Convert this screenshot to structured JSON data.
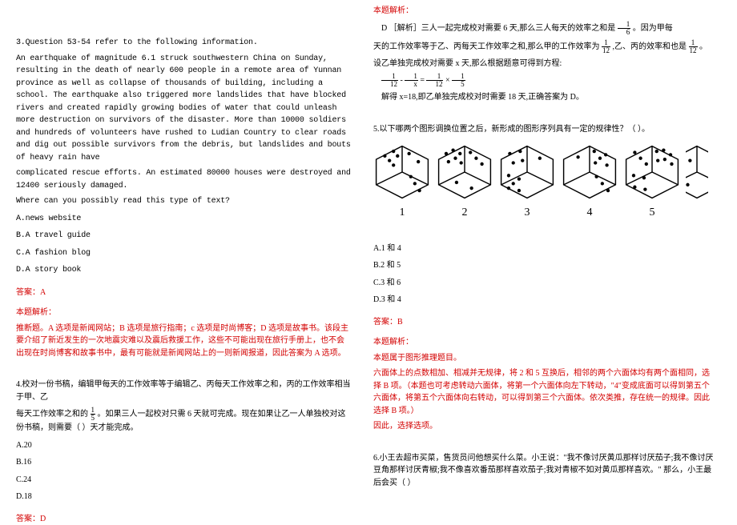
{
  "left": {
    "q3": {
      "lead": "3.Question 53-54 refer to the following information.",
      "passage": "An earthquake of magnitude 6.1 struck southwestern China on Sunday, resulting in the death of nearly 600 people in a remote area of Yunnan province as well as collapse of thousands of building, including a school. The earthquake also triggered more landslides that have blocked rivers and created rapidly growing bodies of water that could unleash more destruction on survivors of the disaster. More than 10000 soldiers and hundreds of volunteers have rushed to Ludian Country to clear roads and dig out possible survivors from the debris, but landslides and bouts of heavy rain have",
      "passage2": "complicated rescue efforts. An estimated 80000 houses were destroyed and 12400 seriously damaged.",
      "question": "Where can you possibly read this type of text?",
      "optA": "A.news website",
      "optB": "B.A travel guide",
      "optC": "C.A fashion blog",
      "optD": "D.A story book",
      "ansLabel": "答案：A",
      "explLabel": "本题解析：",
      "expl": "推断题。A 选项是新闻网站；B 选项是旅行指南；c 选项是时尚博客；D 选项是故事书。该段主要介绍了新近发生的一次地震灾难以及震后救援工作，这些不可能出现在旅行手册上，也不会出现在时尚博客和故事书中，最有可能就是新闻网站上的一则新闻报道，因此答案为 A 选项。"
    },
    "q4": {
      "stem1": "4.校对一份书稿，编辑甲每天的工作效率等于编辑乙、丙每天工作效率之和，丙的工作效率相当于甲、乙",
      "stem2a": "每天工作效率之和的",
      "stem2b": "。如果三人一起校对只需 6 天就可完成。现在如果让乙一人单独校对这份书稿，则需要（ ）天才能完成。",
      "fracN": "1",
      "fracD": "5",
      "optA": "A.20",
      "optB": "B.16",
      "optC": "C.24",
      "optD": "D.18",
      "ansLabel": "答案：D"
    }
  },
  "right": {
    "q4expl": {
      "label": "本题解析：",
      "line1a": "D ［解析］三人一起完成校对需要 6 天,那么三人每天的效率之和是",
      "line1b": "。因为甲每",
      "line2a": "天的工作效率等于乙、丙每天工作效率之和,那么甲的工作效率为",
      "line2b": ",乙、丙的效率和也是",
      "line2c": "。",
      "line3": "设乙单独完成校对需要 x 天,那么根据题意可得到方程:",
      "eq_a": " - ",
      "eq_b": " = ",
      "eq_c": "× ",
      "line4": "解得 x=18,即乙单独完成校对时需要 18 天,正确答案为 D。",
      "f6n": "1",
      "f6d": "6",
      "f12n": "1",
      "f12d": "12",
      "fxn": "1",
      "fxd": "x",
      "f5n": "1",
      "f5d": "5"
    },
    "q5": {
      "stem": "5.以下哪两个图形调换位置之后，新形成的图形序列具有一定的规律性？（ ）。",
      "nums": [
        "1",
        "2",
        "3",
        "4",
        "5"
      ],
      "optA": "A.1 和 4",
      "optB": "B.2 和 5",
      "optC": "C.3 和 6",
      "optD": "D.3 和 4",
      "ansLabel": "答案：B",
      "explLabel": "本题解析：",
      "expl1": "本题属于图形推理题目。",
      "expl2": "六面体上的点数相加、相减并无规律，将 2 和 5 互换后，相邻的两个六面体均有两个面相同，选择 B 项。（本题也可考虑转动六面体，将第一个六面体向左下转动，\"4\"变成底面可以得到第五个六面体，将第五个六面体向右转动，可以得到第三个六面体。依次类推，存在统一的规律。因此选择 B 项。）",
      "expl3": "因此，选择选项。"
    },
    "q6": {
      "stem": "6.小王去超市买菜，售货员问他想买什么菜。小王说：\"我不像讨厌黄瓜那样讨厌茄子;我不像讨厌豆角那样讨厌青椒;我不像喜欢番茄那样喜欢茄子;我对青椒不如对黄瓜那样喜欢。\" 那么，小王最后会买（ ）"
    }
  }
}
